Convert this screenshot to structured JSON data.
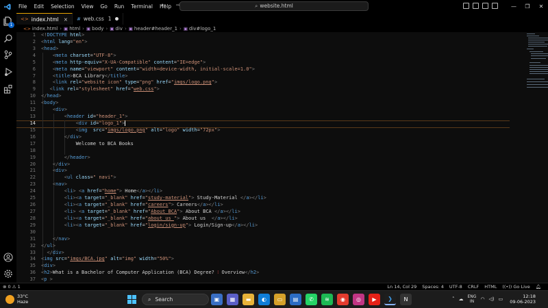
{
  "titlebar": {
    "menu": [
      "File",
      "Edit",
      "Selection",
      "View",
      "Go",
      "Run",
      "Terminal",
      "Help"
    ],
    "search_text": "website.html",
    "accent": "#0a63c9"
  },
  "activity": {
    "explorer_badge": "1"
  },
  "tabs": [
    {
      "ext": "<>",
      "name": "index.html",
      "state": "close"
    },
    {
      "ext": "#",
      "name": "web.css",
      "state": "1 unsaved"
    }
  ],
  "tab_meta": {
    "close_glyph": "×",
    "problem_count": "1"
  },
  "breadcrumbs": [
    "index.html",
    "html",
    "body",
    "div",
    "header#header_1",
    "div#logo_1"
  ],
  "editor": {
    "line_numbers": [
      "1",
      "2",
      "3",
      "4",
      "5",
      "6",
      "7",
      "8",
      "9",
      "10",
      "11",
      "12",
      "13",
      "14",
      "15",
      "16",
      "17",
      "18",
      "19",
      "20",
      "21",
      "22",
      "23",
      "24",
      "25",
      "26",
      "27",
      "28",
      "29",
      "30",
      "31",
      "32",
      "33",
      "34",
      "35",
      "36",
      "37"
    ],
    "current_line": "14"
  },
  "status": {
    "problems": "⊗ 0 ⚠ 1",
    "cursor": "Ln 14, Col 29",
    "spaces": "Spaces: 4",
    "encoding": "UTF-8",
    "eol": "CRLF",
    "language": "HTML",
    "live": "Go Live"
  },
  "taskbar": {
    "temp": "33°C",
    "weather": "Haze",
    "search_label": "Search",
    "lang_top": "ENG",
    "lang_bottom": "IN",
    "time": "12:18",
    "date": "09-06-2023"
  }
}
